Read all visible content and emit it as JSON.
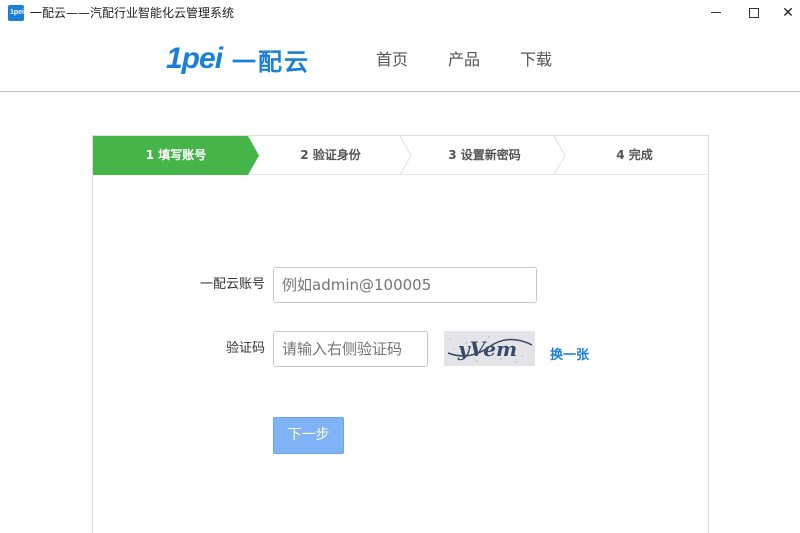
{
  "window": {
    "icon_text": "1pei",
    "title": "一配云——汽配行业智能化云管理系统",
    "minimize_label": "—",
    "maximize_label": "☐",
    "close_label": "✕"
  },
  "header": {
    "logo_mark": "1pei",
    "logo_text": "一配云",
    "nav": {
      "home": "首页",
      "product": "产品",
      "download": "下载"
    }
  },
  "steps": [
    {
      "label": "1 填写账号",
      "active": true
    },
    {
      "label": "2 验证身份",
      "active": false
    },
    {
      "label": "3 设置新密码",
      "active": false
    },
    {
      "label": "4 完成",
      "active": false
    }
  ],
  "form": {
    "account_label": "一配云账号",
    "account_placeholder": "例如admin@100005",
    "captcha_label": "验证码",
    "captcha_placeholder": "请输入右侧验证码",
    "captcha_text": "yVem",
    "refresh_captcha": "换一张",
    "next_button": "下一步"
  },
  "colors": {
    "brand_blue": "#1a7fd8",
    "step_active_green": "#45b549",
    "next_button": "#7fb3f5"
  }
}
